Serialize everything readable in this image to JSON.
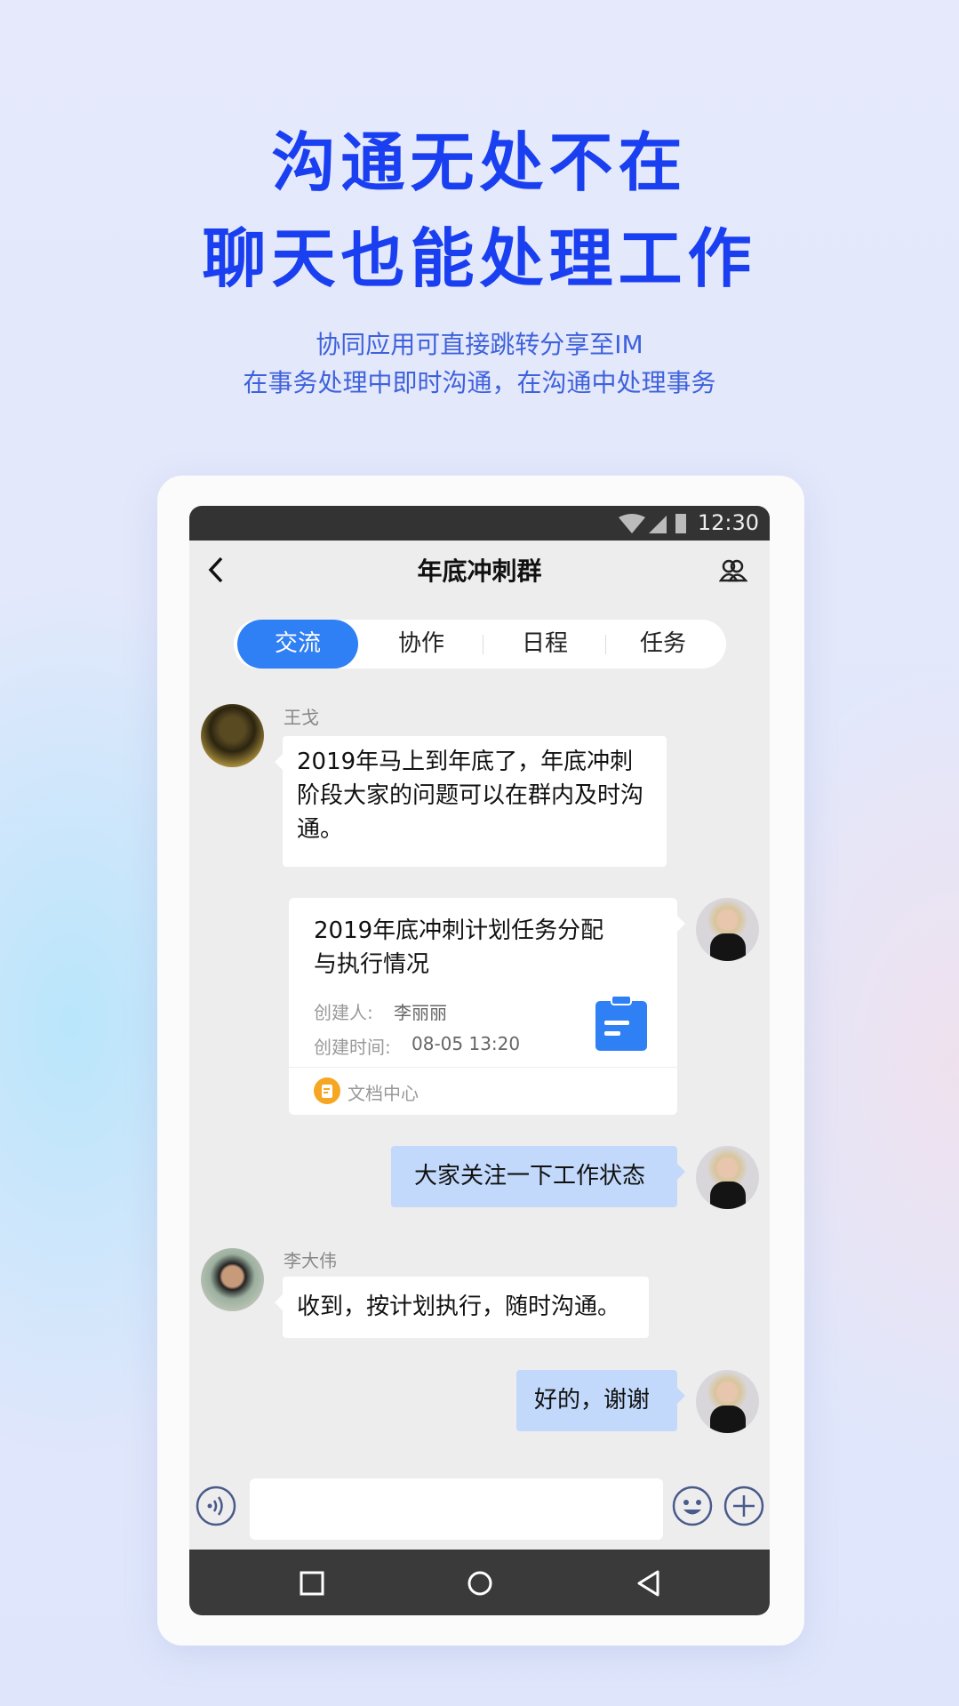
{
  "headline": {
    "line1": "沟通无处不在",
    "line2": "聊天也能处理工作"
  },
  "subtitle": {
    "line1": "协同应用可直接跳转分享至IM",
    "line2": "在事务处理中即时沟通，在沟通中处理事务"
  },
  "status_bar": {
    "time": "12:30",
    "icons": [
      "wifi-icon",
      "signal-icon",
      "battery-icon"
    ]
  },
  "header": {
    "title": "年底冲刺群",
    "back_icon": "chevron-left-icon",
    "members_icon": "group-icon"
  },
  "tabs": [
    {
      "label": "交流",
      "active": true
    },
    {
      "label": "协作"
    },
    {
      "label": "日程"
    },
    {
      "label": "任务"
    }
  ],
  "accent": "#2f7ff5",
  "messages": [
    {
      "sender": "王戈",
      "text": "2019年马上到年底了，年底冲刺阶段大家的问题可以在群内及时沟通。"
    },
    {
      "card": {
        "title": "2019年底冲刺计划任务分配与执行情况",
        "creator_label": "创建人:",
        "creator": "李丽丽",
        "time_label": "创建时间:",
        "time": "08-05 13:20",
        "source": "文档中心"
      }
    },
    {
      "text": "大家关注一下工作状态"
    },
    {
      "sender": "李大伟",
      "text": "收到，按计划执行，随时沟通。"
    },
    {
      "text": "好的，谢谢"
    }
  ],
  "input": {
    "value": ""
  }
}
